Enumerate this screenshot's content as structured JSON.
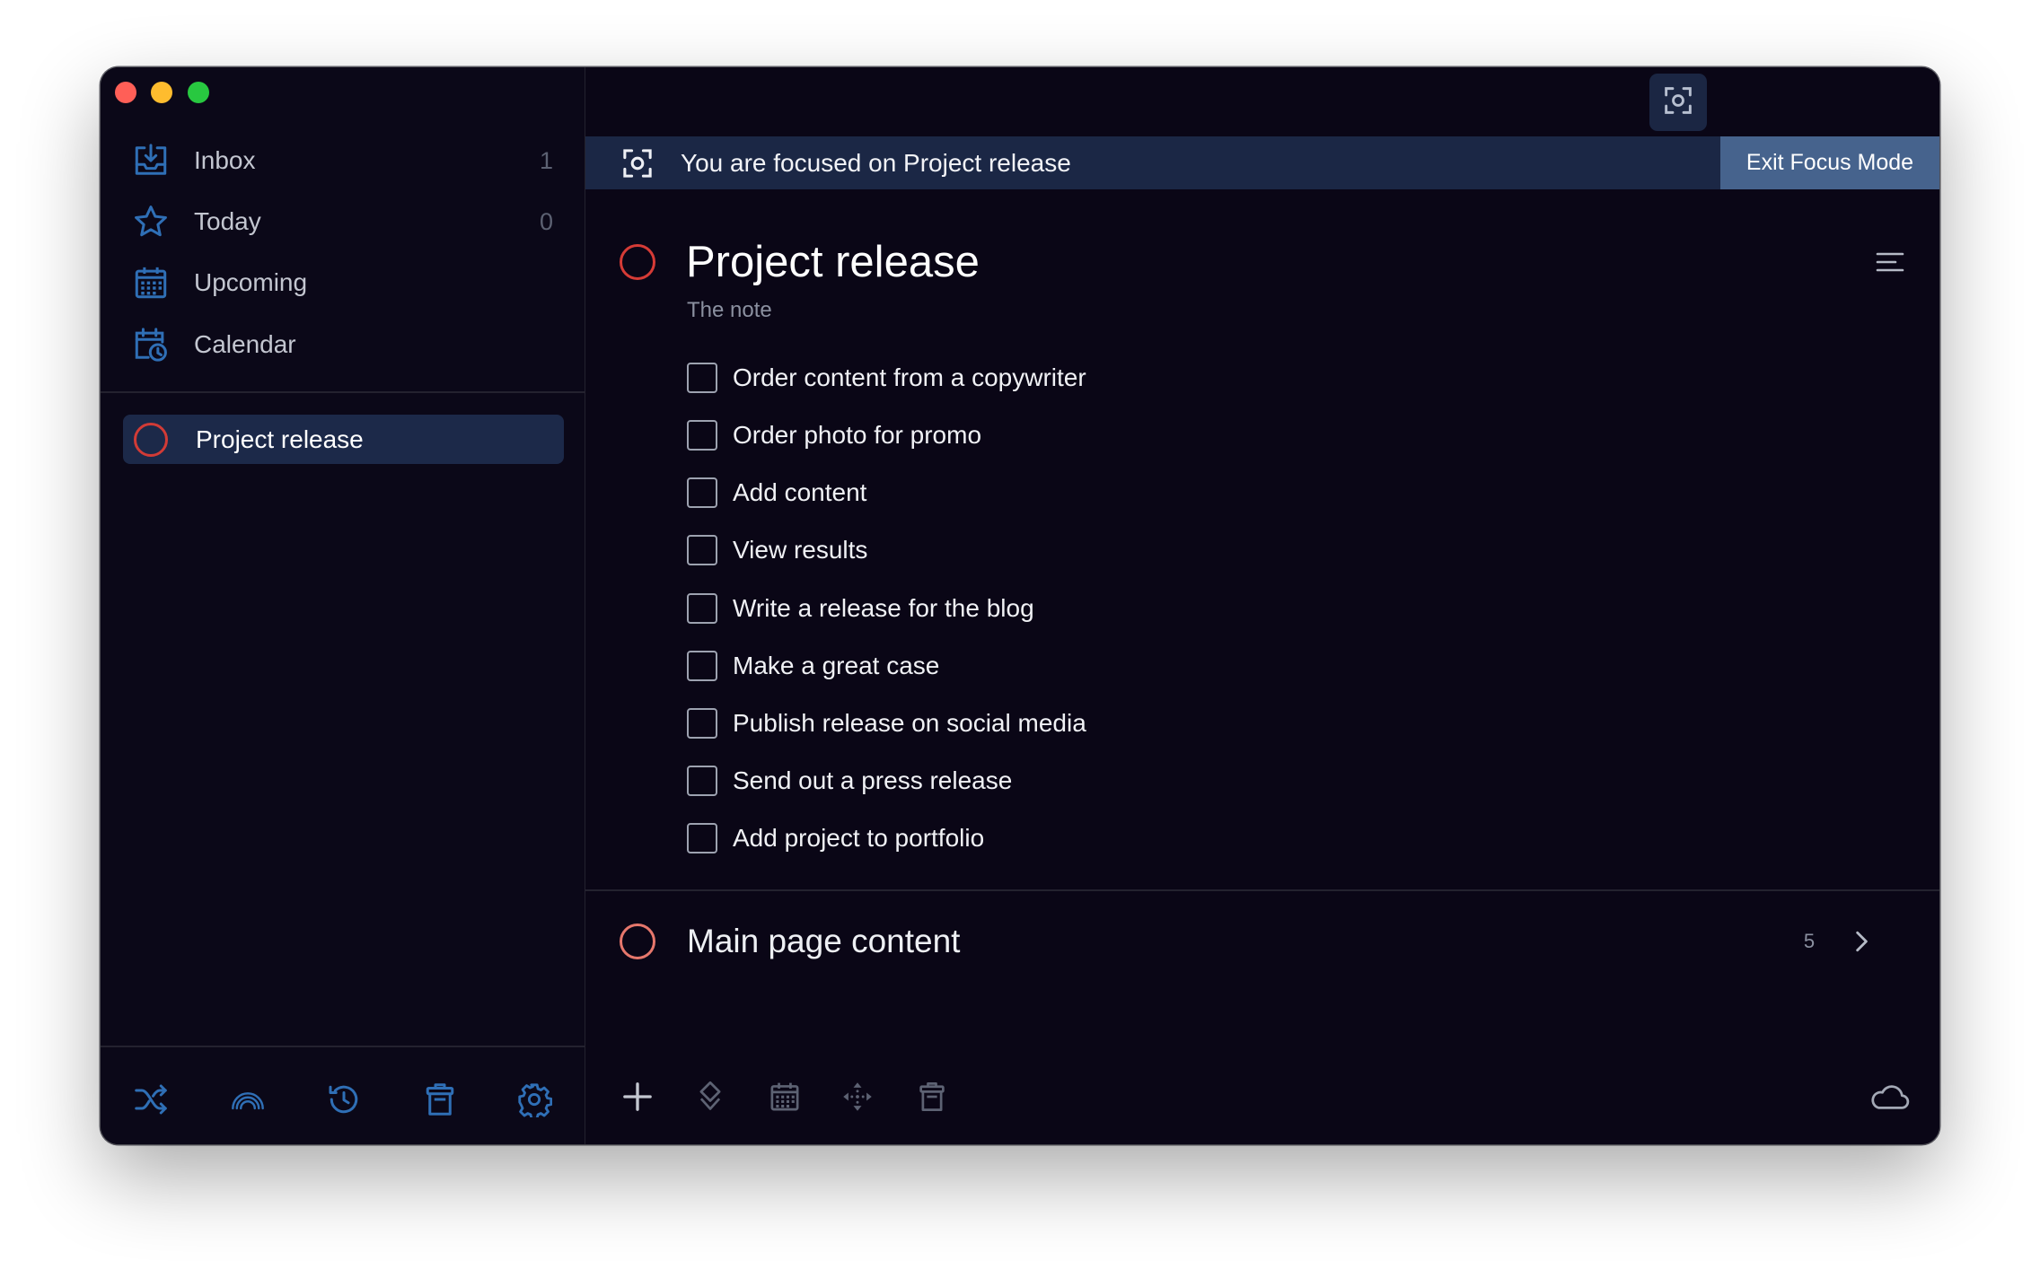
{
  "sidebar": {
    "nav": [
      {
        "label": "Inbox",
        "count": "1",
        "icon": "inbox-icon"
      },
      {
        "label": "Today",
        "count": "0",
        "icon": "star-icon"
      },
      {
        "label": "Upcoming",
        "icon": "calendar-grid-icon"
      },
      {
        "label": "Calendar",
        "icon": "calendar-clock-icon"
      }
    ],
    "projects": [
      {
        "label": "Project release",
        "selected": true,
        "icon": "circle-outline-icon"
      }
    ],
    "footer_icons": [
      "shuffle-icon",
      "rainbow-icon",
      "history-icon",
      "trash-icon",
      "settings-icon"
    ]
  },
  "main": {
    "focus_button_icon": "focus-icon",
    "focus_banner": {
      "icon": "focus-icon",
      "text": "You are focused on Project release",
      "exit_label": "Exit Focus Mode"
    },
    "project": {
      "title": "Project release",
      "note": "The note",
      "menu_icon": "menu-icon",
      "tasks": [
        {
          "label": "Order content from a copywriter",
          "done": false
        },
        {
          "label": "Order photo for promo",
          "done": false
        },
        {
          "label": "Add content",
          "done": false
        },
        {
          "label": "View results",
          "done": false
        },
        {
          "label": "Write a release for the blog",
          "done": false
        },
        {
          "label": "Make a great case",
          "done": false
        },
        {
          "label": "Publish release on social media",
          "done": false
        },
        {
          "label": "Send out a press release",
          "done": false
        },
        {
          "label": "Add project to portfolio",
          "done": false
        }
      ]
    },
    "sections": [
      {
        "title": "Main page content",
        "count": "5",
        "icon": "chevron-right-icon"
      }
    ],
    "toolbar": {
      "icons": [
        "plus-icon",
        "diamond-icon",
        "calendar-grid-icon",
        "move-icon",
        "trash-icon"
      ],
      "status_icon": "cloud-icon"
    }
  },
  "colors": {
    "accent": "#2f6fb6",
    "project_circle": "#d63b36",
    "section_circle": "#e6776c",
    "selected_bg": "#1c2949",
    "banner_bg": "#1b2745",
    "exit_button_bg": "#46638d",
    "background": "#0a0716",
    "traffic_close": "#ff5f57",
    "traffic_minimize": "#febc2e",
    "traffic_zoom": "#28c840"
  }
}
